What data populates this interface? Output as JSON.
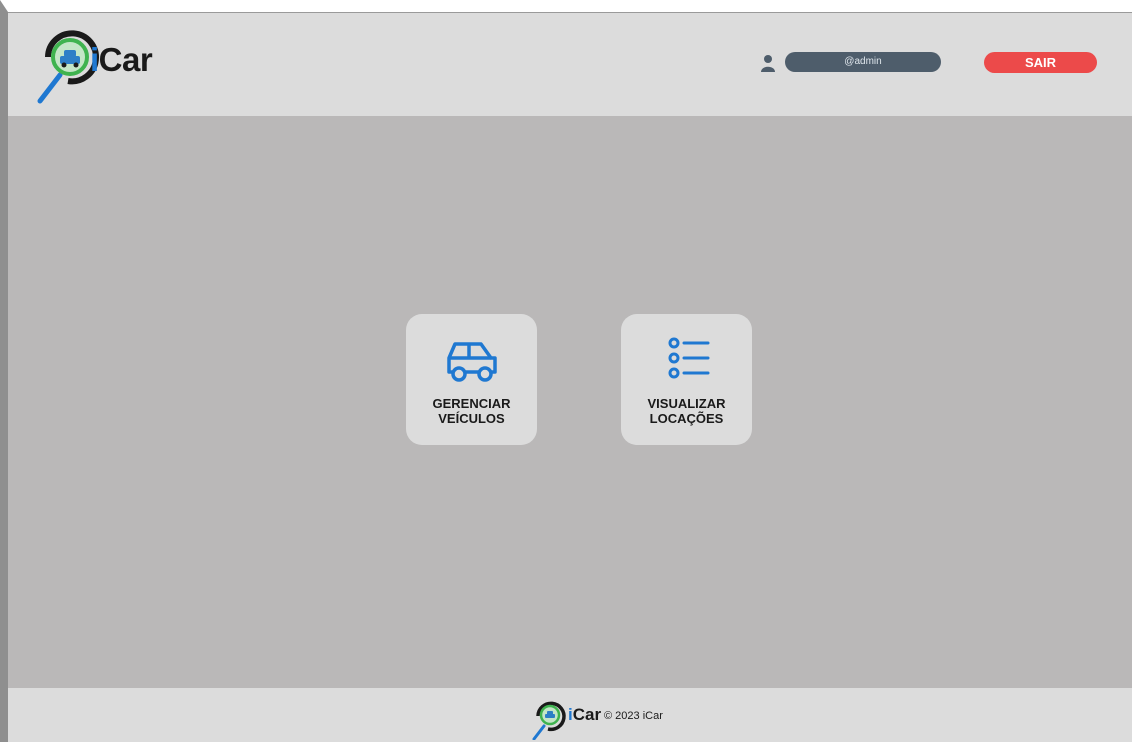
{
  "header": {
    "logo_i": "i",
    "logo_rest": "Car",
    "user_name": "@admin",
    "logout_label": "SAIR"
  },
  "main": {
    "cards": [
      {
        "label": "GERENCIAR\nVEÍCULOS",
        "icon": "car-icon"
      },
      {
        "label": "VISUALIZAR\nLOCAÇÕES",
        "icon": "list-icon"
      }
    ]
  },
  "footer": {
    "logo_i": "i",
    "logo_rest": "Car",
    "copyright": "© 2023 iCar"
  },
  "colors": {
    "accent_blue": "#1f78d1",
    "logout_red": "#ec4a4a",
    "user_pill": "#4e5d6b",
    "logo_green": "#3fb34f"
  }
}
